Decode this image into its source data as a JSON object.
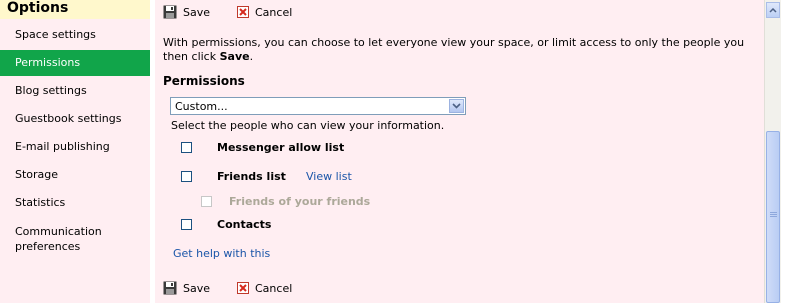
{
  "sidebar": {
    "title": "Options",
    "items": [
      {
        "label": "Space settings"
      },
      {
        "label": "Permissions"
      },
      {
        "label": "Blog settings"
      },
      {
        "label": "Guestbook settings"
      },
      {
        "label": "E-mail publishing"
      },
      {
        "label": "Storage"
      },
      {
        "label": "Statistics"
      },
      {
        "label": "Communication",
        "label2": "preferences"
      }
    ],
    "active": "Permissions"
  },
  "toolbar": {
    "save_label": "Save",
    "cancel_label": "Cancel"
  },
  "intro": {
    "line1": "With permissions, you can choose to let everyone view your space, or limit access to only the people you",
    "line2_prefix": "then click ",
    "line2_bold": "Save",
    "line2_suffix": "."
  },
  "permissions": {
    "title": "Permissions",
    "select_value": "Custom...",
    "hint": "Select the people who can view your information.",
    "options": {
      "messenger": "Messenger allow list",
      "friends": "Friends list",
      "view_list": "View list",
      "friends_of_friends": "Friends of your friends",
      "contacts": "Contacts"
    },
    "help_link": "Get help with this"
  },
  "colors": {
    "active_bg": "#11a54a",
    "panel_bg": "#ffeef2",
    "header_bg": "#fff8cc",
    "link": "#1a55a8"
  }
}
